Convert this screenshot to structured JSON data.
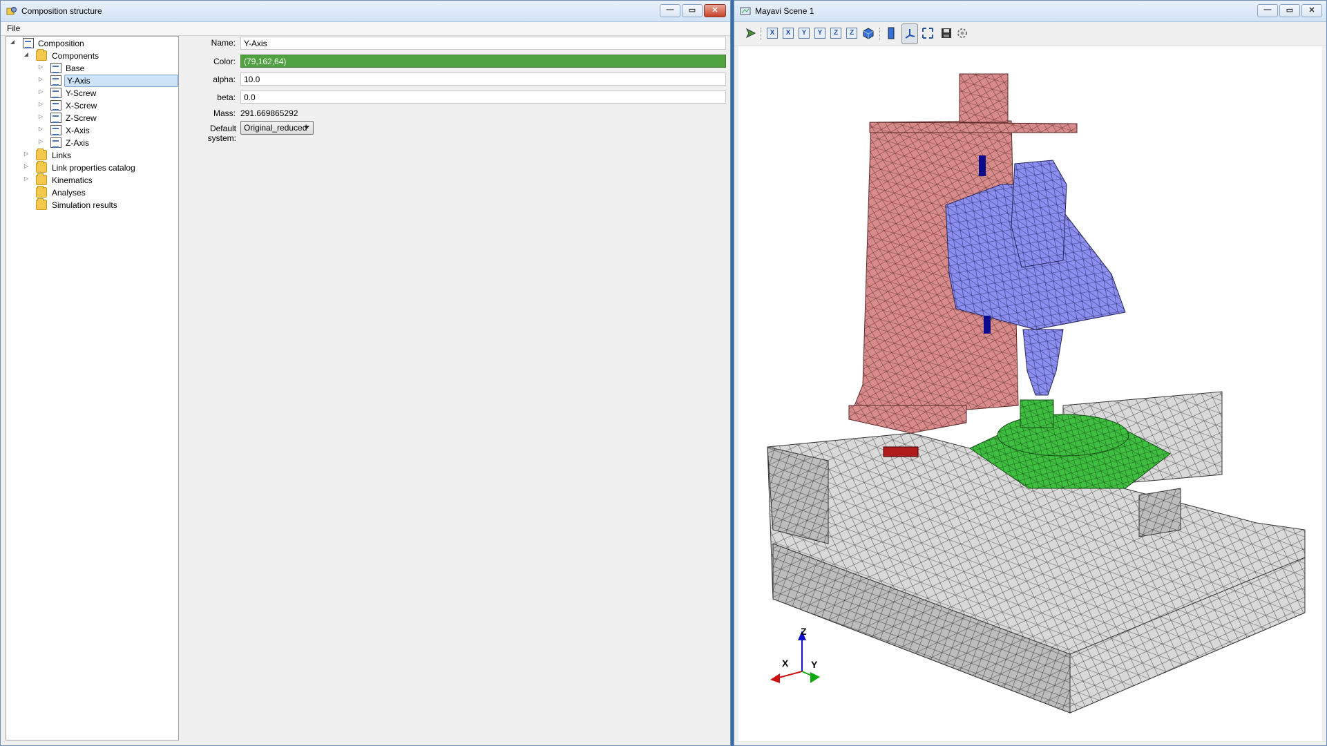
{
  "left_window": {
    "title": "Composition structure",
    "menu": {
      "file": "File"
    },
    "tree": {
      "root": "Composition",
      "components": "Components",
      "items": [
        "Base",
        "Y-Axis",
        "Y-Screw",
        "X-Screw",
        "Z-Screw",
        "X-Axis",
        "Z-Axis"
      ],
      "links": "Links",
      "link_catalog": "Link properties catalog",
      "kinematics": "Kinematics",
      "analyses": "Analyses",
      "simulation_results": "Simulation results"
    },
    "properties": {
      "name_label": "Name:",
      "name_value": "Y-Axis",
      "color_label": "Color:",
      "color_value": "(79,162,64)",
      "color_hex": "#4fa240",
      "alpha_label": "alpha:",
      "alpha_value": "10.0",
      "beta_label": "beta:",
      "beta_value": "0.0",
      "mass_label": "Mass:",
      "mass_value": "291.669865292",
      "default_system_label": "Default system:",
      "default_system_value": "Original_reduced"
    }
  },
  "right_window": {
    "title": "Mayavi Scene 1",
    "toolbar": {
      "axis_buttons": [
        "X",
        "X",
        "Y",
        "Y",
        "Z",
        "Z"
      ]
    },
    "orientation_axes": {
      "x": "X",
      "y": "Y",
      "z": "Z"
    }
  },
  "window_buttons": {
    "minimize": "—",
    "maximize": "▭",
    "close": "✕"
  }
}
